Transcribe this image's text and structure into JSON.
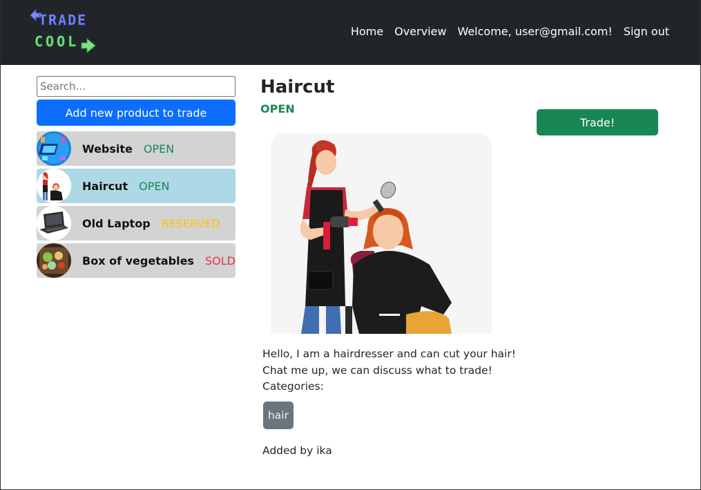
{
  "brand": {
    "logo_line1": "TRADE",
    "logo_line2": "COOL"
  },
  "nav": {
    "home": "Home",
    "overview": "Overview",
    "welcome": "Welcome, user@gmail.com!",
    "signout": "Sign out"
  },
  "sidebar": {
    "search_placeholder": "Search...",
    "add_button": "Add new product to trade",
    "items": [
      {
        "name": "Website",
        "status": "OPEN",
        "thumb": "website-image"
      },
      {
        "name": "Haircut",
        "status": "OPEN",
        "thumb": "haircut-image"
      },
      {
        "name": "Old Laptop",
        "status": "RESERVED",
        "thumb": "laptop-image"
      },
      {
        "name": "Box of vegetables",
        "status": "SOLD",
        "thumb": "vegetables-image"
      }
    ]
  },
  "product": {
    "title": "Haircut",
    "status": "OPEN",
    "trade_button": "Trade!",
    "description": "Hello, I am a hairdresser and can cut your hair! Chat me up, we can discuss what to trade!",
    "categories_label": "Categories:",
    "categories": [
      "hair"
    ],
    "added_by": "Added by ika"
  },
  "colors": {
    "navbar": "#212529",
    "primary": "#0d6efd",
    "success": "#198754",
    "warning": "#ffc107",
    "danger": "#dc3545",
    "active_item": "#add8e6",
    "item_bg": "#d3d3d3",
    "badge": "#6c757d"
  }
}
